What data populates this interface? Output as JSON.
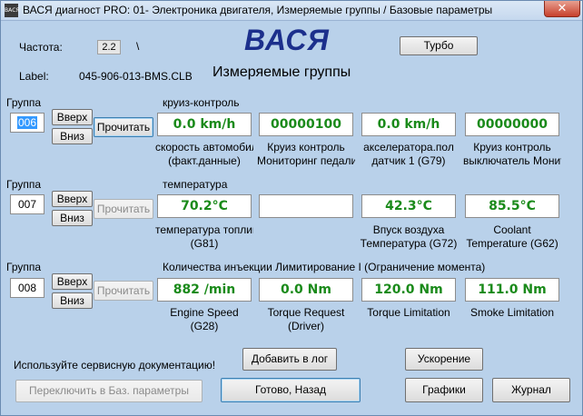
{
  "window": {
    "title": "ВАСЯ диагност PRO: 01- Электроника двигателя,  Измеряемые группы / Базовые параметры",
    "app_icon_text": "ВАСЯ",
    "close_glyph": "✕"
  },
  "header": {
    "freq_label": "Частота:",
    "freq_value": "2.2",
    "freq_slash": "\\",
    "logo": "ВАСЯ",
    "turbo_button": "Турбо",
    "label_label": "Label:",
    "label_value": "045-906-013-BMS.CLB",
    "section_title": "Измеряемые группы"
  },
  "groups": [
    {
      "group_label": "Группа",
      "number": "006",
      "up_button": "Вверх",
      "down_button": "Вниз",
      "read_button": "Прочитать",
      "title": "круиз-контроль",
      "values": [
        "0.0 km/h",
        "00000100",
        "0.0 km/h",
        "00000000"
      ],
      "captions": [
        [
          "скорость автомобиля",
          "(факт.данные)"
        ],
        [
          "Круиз контроль",
          "Мониторинг педали"
        ],
        [
          "акселератора.пол",
          "датчик 1 (G79)"
        ],
        [
          "Круиз контроль",
          "выключатель Монитор"
        ]
      ]
    },
    {
      "group_label": "Группа",
      "number": "007",
      "up_button": "Вверх",
      "down_button": "Вниз",
      "read_button": "Прочитать",
      "title": "температура",
      "values": [
        "70.2°C",
        "",
        "42.3°C",
        "85.5°C"
      ],
      "captions": [
        [
          "температура топлива",
          "(G81)"
        ],
        [
          "",
          ""
        ],
        [
          "Впуск воздуха",
          "Температура (G72)"
        ],
        [
          "Coolant",
          "Temperature (G62)"
        ]
      ]
    },
    {
      "group_label": "Группа",
      "number": "008",
      "up_button": "Вверх",
      "down_button": "Вниз",
      "read_button": "Прочитать",
      "title": "Количества инъекции Лимитирование I (Ограничение момента)",
      "values": [
        "882 /min",
        "0.0 Nm",
        "120.0 Nm",
        "111.0 Nm"
      ],
      "captions": [
        [
          "Engine Speed",
          "(G28)"
        ],
        [
          "Torque Request",
          "(Driver)"
        ],
        [
          "Torque Limitation",
          ""
        ],
        [
          "Smoke Limitation",
          ""
        ]
      ]
    }
  ],
  "footer": {
    "docs_text": "Используйте сервисную документацию!",
    "add_log_button": "Добавить в лог",
    "accel_button": "Ускорение",
    "switch_basic_button": "Переключить в Баз. параметры",
    "done_back_button": "Готово, Назад",
    "graphs_button": "Графики",
    "journal_button": "Журнал"
  },
  "colors": {
    "background": "#b9d1ea",
    "logo": "#1c2f8c",
    "value_text": "#1a8a1a",
    "close_button": "#c7402c"
  }
}
